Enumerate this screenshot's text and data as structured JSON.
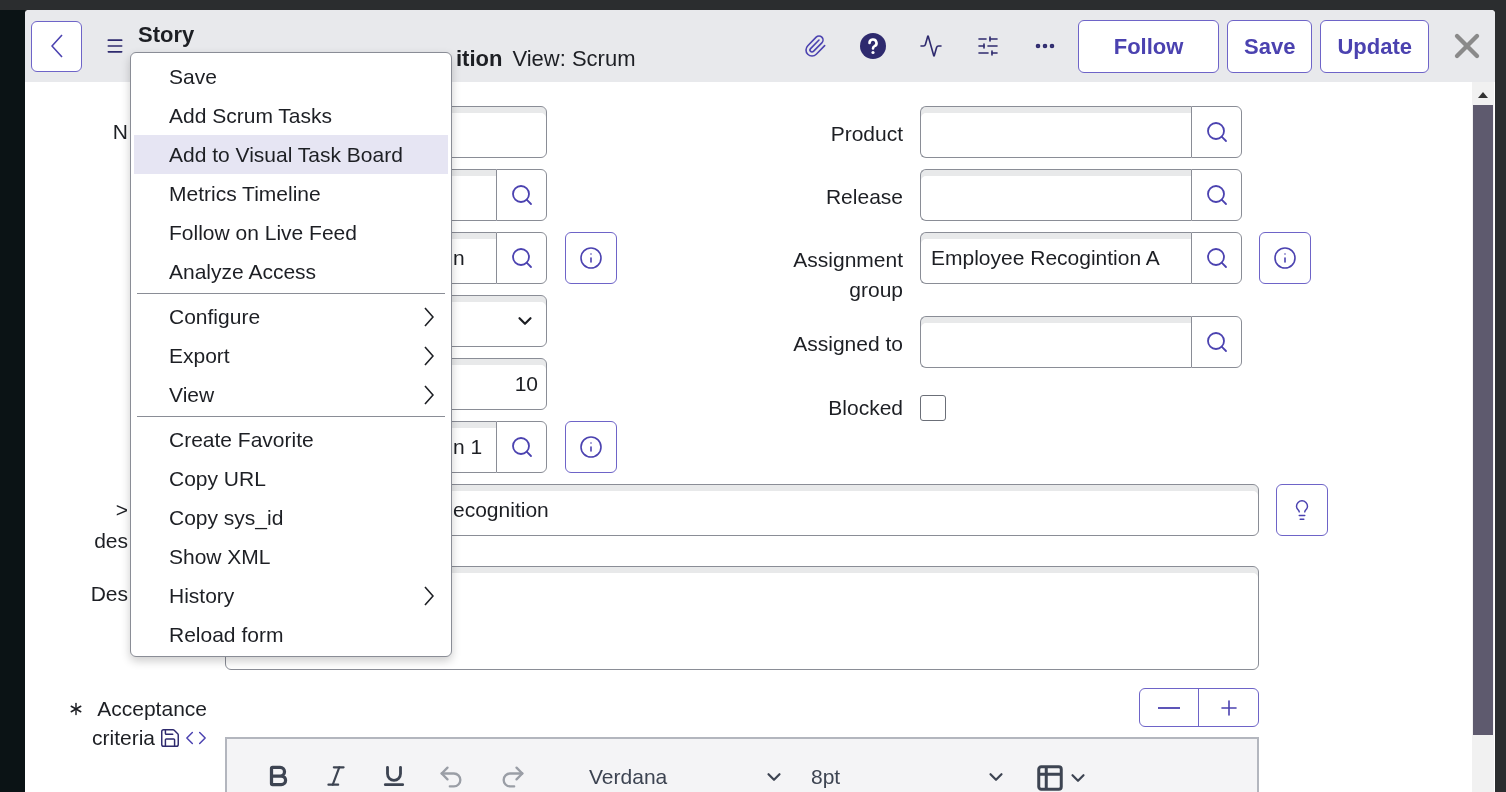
{
  "header": {
    "title": "Story",
    "subtitle": "ition",
    "view": "View: Scrum",
    "actions": [
      {
        "label": "Follow"
      },
      {
        "label": "Save"
      },
      {
        "label": "Update"
      }
    ]
  },
  "context_menu": {
    "groups": [
      [
        {
          "label": "Save",
          "selected": false,
          "submenu": false
        },
        {
          "label": "Add Scrum Tasks",
          "selected": false,
          "submenu": false
        },
        {
          "label": "Add to Visual Task Board",
          "selected": true,
          "submenu": false
        },
        {
          "label": "Metrics Timeline",
          "selected": false,
          "submenu": false
        },
        {
          "label": "Follow on Live Feed",
          "selected": false,
          "submenu": false
        },
        {
          "label": "Analyze Access",
          "selected": false,
          "submenu": false
        }
      ],
      [
        {
          "label": "Configure",
          "selected": false,
          "submenu": true
        },
        {
          "label": "Export",
          "selected": false,
          "submenu": true
        },
        {
          "label": "View",
          "selected": false,
          "submenu": true
        }
      ],
      [
        {
          "label": "Create Favorite",
          "selected": false,
          "submenu": false
        },
        {
          "label": "Copy URL",
          "selected": false,
          "submenu": false
        },
        {
          "label": "Copy sys_id",
          "selected": false,
          "submenu": false
        },
        {
          "label": "Show XML",
          "selected": false,
          "submenu": false
        },
        {
          "label": "History",
          "selected": false,
          "submenu": true
        },
        {
          "label": "Reload form",
          "selected": false,
          "submenu": false
        }
      ]
    ]
  },
  "form": {
    "left_fields": [
      {
        "label": "N",
        "kind": "text",
        "info": false
      },
      {
        "kind": "lookup",
        "info": false
      },
      {
        "kind": "lookup",
        "value": "n",
        "info": true
      },
      {
        "kind": "select",
        "info": false
      },
      {
        "kind": "number",
        "value": "10",
        "info": false
      },
      {
        "kind": "lookup",
        "value": "n 1",
        "info": true
      }
    ],
    "right_fields": [
      {
        "label": "Product",
        "kind": "lookup",
        "info": false
      },
      {
        "label": "Release",
        "kind": "lookup",
        "info": false
      },
      {
        "label": "Assignment group",
        "kind": "lookup",
        "value": "Employee Recogintion A",
        "info": true
      },
      {
        "label": "Assigned to",
        "kind": "lookup",
        "info": false
      },
      {
        "label": "Blocked",
        "kind": "checkbox",
        "checked": false
      }
    ],
    "short_description": {
      "label_lines": [
        ">",
        "des"
      ],
      "value": "ecognition"
    },
    "description": {
      "label": "Des"
    },
    "acceptance_criteria": {
      "label_lines": [
        "Acceptance",
        "criteria"
      ],
      "required": true
    },
    "editor": {
      "font": "Verdana",
      "size": "8pt"
    }
  }
}
